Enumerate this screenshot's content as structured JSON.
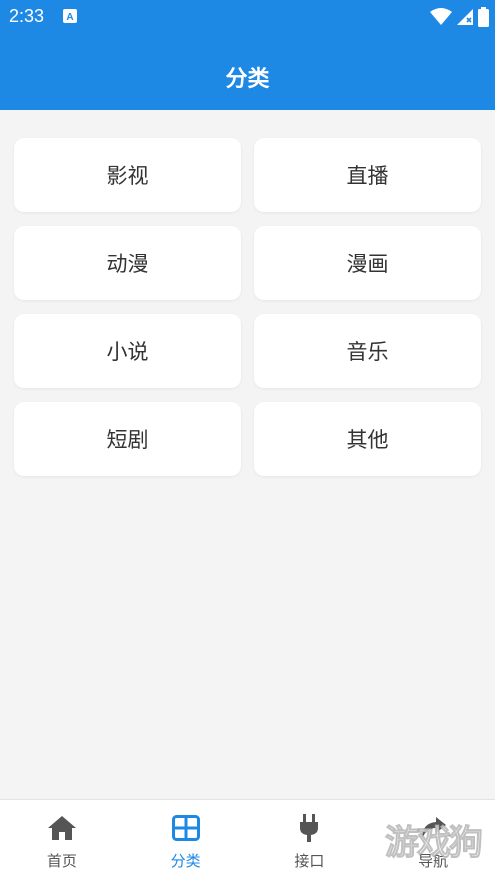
{
  "status": {
    "time": "2:33"
  },
  "appbar": {
    "title": "分类"
  },
  "categories": [
    {
      "label": "影视"
    },
    {
      "label": "直播"
    },
    {
      "label": "动漫"
    },
    {
      "label": "漫画"
    },
    {
      "label": "小说"
    },
    {
      "label": "音乐"
    },
    {
      "label": "短剧"
    },
    {
      "label": "其他"
    }
  ],
  "nav": {
    "items": [
      {
        "label": "首页",
        "icon": "home-icon"
      },
      {
        "label": "分类",
        "icon": "grid-icon",
        "active": true
      },
      {
        "label": "接口",
        "icon": "plug-icon"
      },
      {
        "label": "导航",
        "icon": "share-icon"
      }
    ]
  },
  "watermark": "游戏狗",
  "colors": {
    "primary": "#1e88e5",
    "background": "#f4f4f4",
    "card": "#ffffff"
  }
}
